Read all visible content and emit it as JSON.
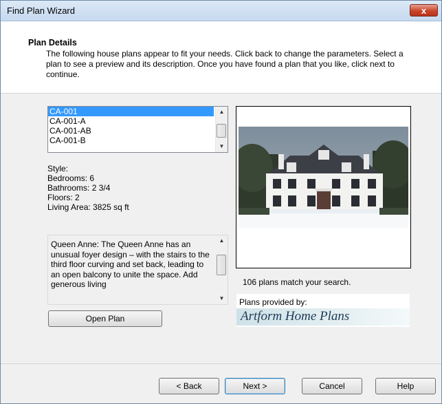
{
  "window": {
    "title": "Find Plan Wizard",
    "close_glyph": "x"
  },
  "header": {
    "title": "Plan Details",
    "description": "The following house plans appear to fit your needs. Click back to change the parameters.  Select a plan to see a preview and its description. Once you have found a plan that you like, click next to continue."
  },
  "plan_list": {
    "items": [
      "CA-001",
      "CA-001-A",
      "CA-001-AB",
      "CA-001-B"
    ],
    "selected": "CA-001"
  },
  "details": {
    "style": "Style:",
    "bedrooms": "Bedrooms: 6",
    "bathrooms": "Bathrooms: 2 3/4",
    "floors": "Floors: 2",
    "living_area": "Living Area: 3825 sq ft"
  },
  "description": {
    "text": "Queen Anne:  The Queen Anne has an unusual foyer design – with the stairs to the third floor curving and set back, leading to an open balcony to unite the space.  Add generous living"
  },
  "buttons": {
    "open_plan": "Open Plan",
    "back": "< Back",
    "next": "Next >",
    "cancel": "Cancel",
    "help": "Help"
  },
  "preview": {
    "icon": "house-photo"
  },
  "match_count": "106 plans match your search.",
  "provider": {
    "label": "Plans provided by:",
    "brand": "Artform Home Plans"
  },
  "colors": {
    "selection": "#3399ff",
    "close_button": "#c9452b"
  }
}
